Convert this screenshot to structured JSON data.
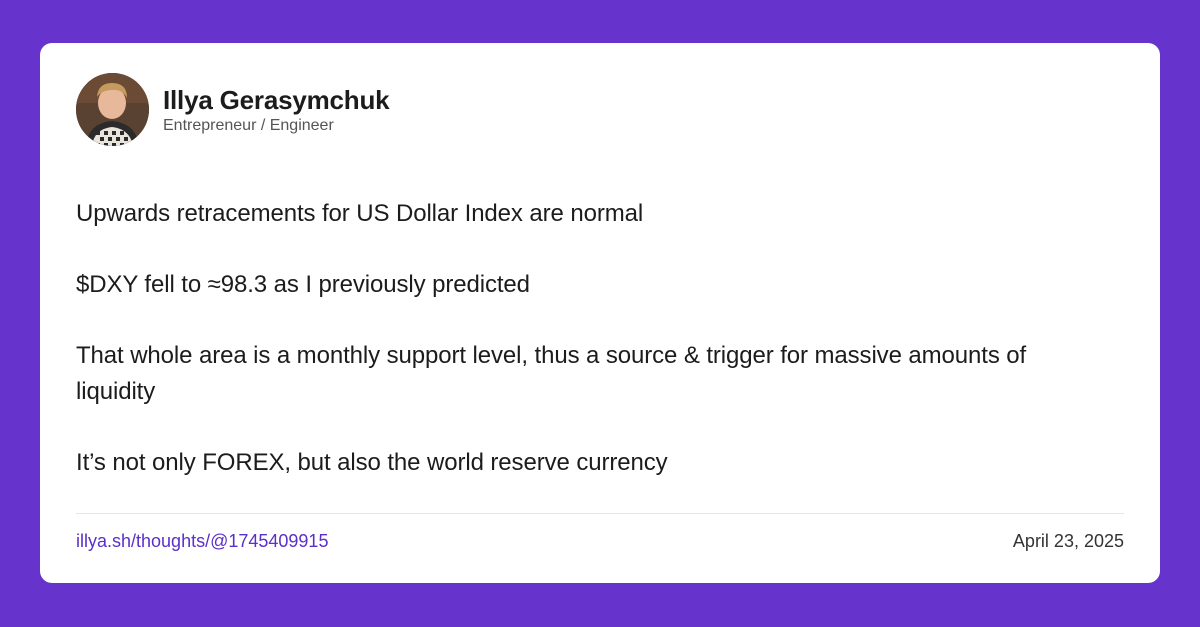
{
  "theme": {
    "background_color": "#6633cc",
    "card_color": "#ffffff",
    "link_color": "#5b2fc9"
  },
  "author": {
    "avatar_icon": "user-avatar-photo",
    "name": "Illya Gerasymchuk",
    "title": "Entrepreneur / Engineer"
  },
  "post": {
    "paragraphs": [
      "Upwards retracements for US Dollar Index are normal",
      "$DXY fell to ≈98.3 as I previously predicted",
      "That whole area is a monthly support level, thus a source & trigger for massive amounts of liquidity",
      "It’s not only FOREX, but also the world reserve currency"
    ]
  },
  "footer": {
    "link_text": "illya.sh/thoughts/@1745409915",
    "date": "April 23, 2025"
  }
}
